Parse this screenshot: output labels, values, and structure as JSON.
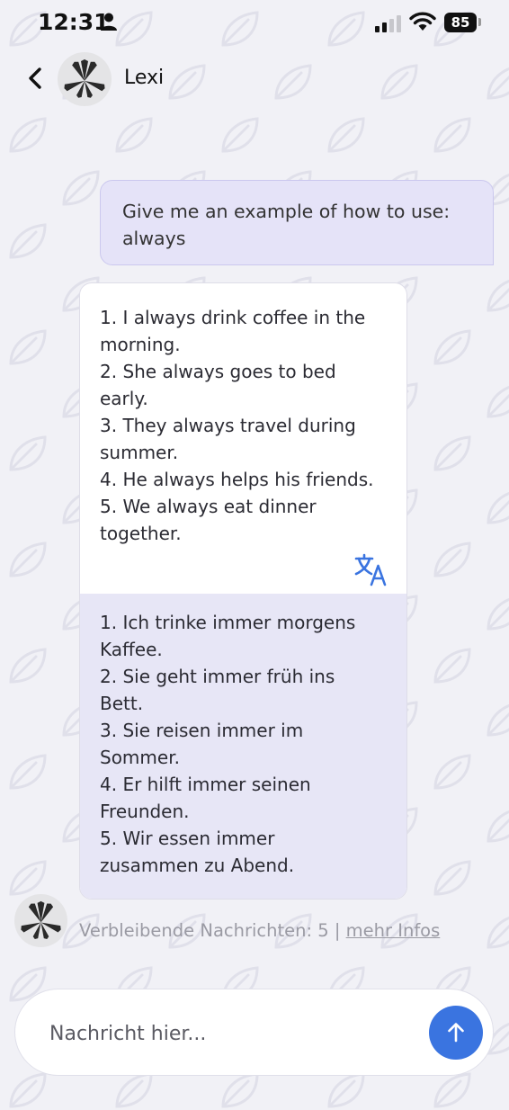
{
  "status_bar": {
    "time": "12:31",
    "battery": "85"
  },
  "header": {
    "contact_name": "Lexi"
  },
  "messages": {
    "user": {
      "lines": [
        "Give me an example of how to use:",
        "always"
      ]
    },
    "bot": {
      "lines": [
        "1. I always drink coffee in the",
        "morning.",
        "2. She always goes to bed",
        "early.",
        "3. They always travel during",
        "summer.",
        "4. He always helps his friends.",
        "5. We always eat dinner",
        "together."
      ],
      "translation_lines": [
        "1. Ich trinke immer morgens",
        "Kaffee.",
        "2. Sie geht immer früh ins",
        "Bett.",
        "3. Sie reisen immer im",
        "Sommer.",
        "4. Er hilft immer seinen",
        "Freunden.",
        "5. Wir essen immer",
        "zusammen zu Abend."
      ]
    }
  },
  "footer": {
    "remaining_text": "Verbleibende Nachrichten: 5 | ",
    "more_info_label": "mehr Infos"
  },
  "composer": {
    "placeholder": "Nachricht hier..."
  },
  "colors": {
    "accent": "#3a74e0",
    "user_bubble": "#e5e3f8",
    "translation_background": "#e7e6f6",
    "background": "#f1f1f6"
  },
  "icons": [
    "person-icon",
    "signal-icon",
    "wifi-icon",
    "battery-icon",
    "back-chevron-icon",
    "translate-icon",
    "arrow-up-icon",
    "leaf-pattern"
  ]
}
